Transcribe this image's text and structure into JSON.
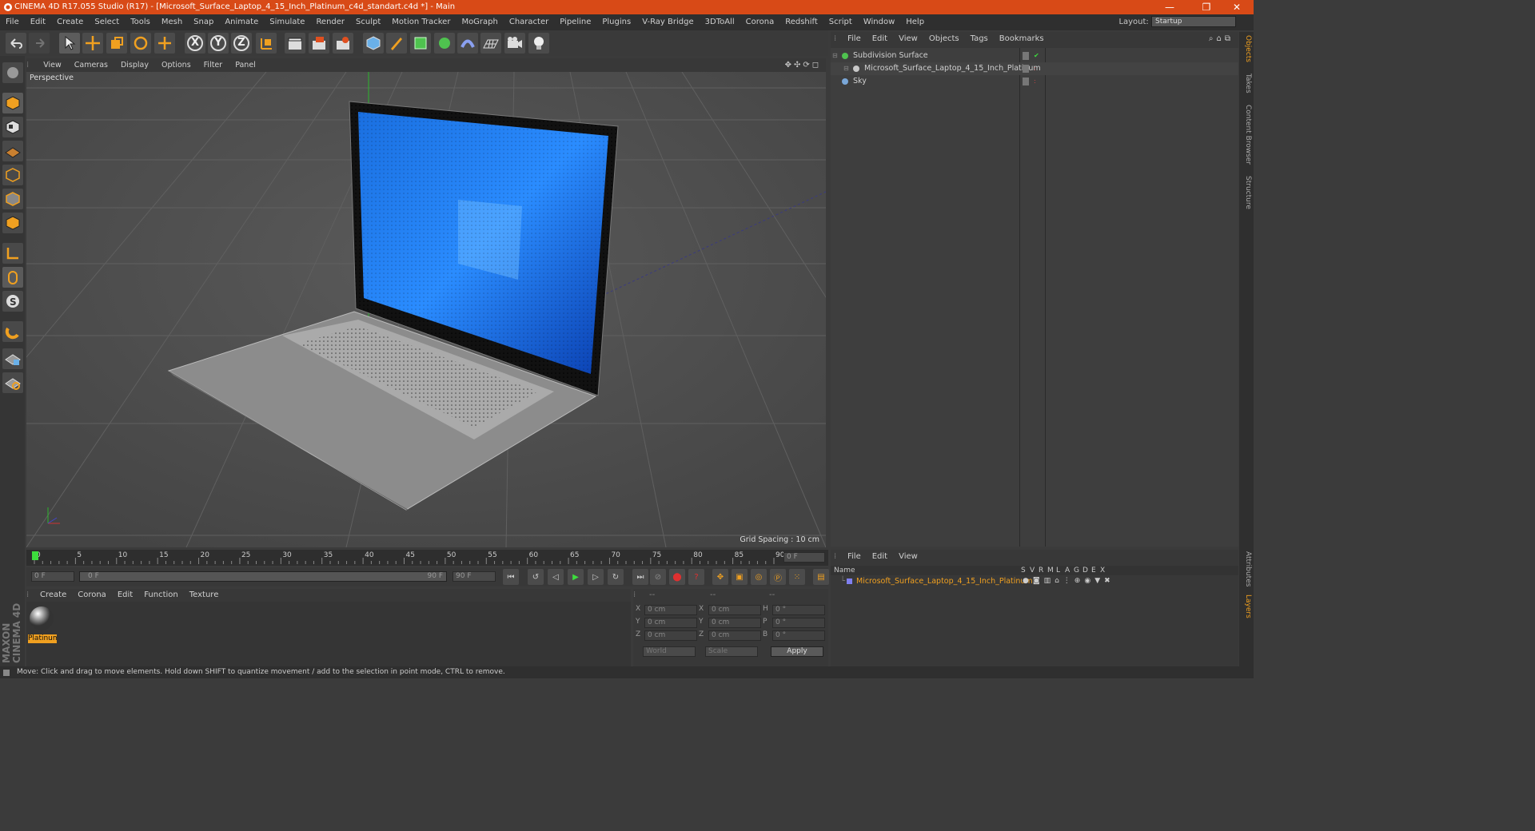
{
  "window": {
    "title": "CINEMA 4D R17.055 Studio (R17) - [Microsoft_Surface_Laptop_4_15_Inch_Platinum_c4d_standart.c4d *] - Main",
    "minimize": "—",
    "restore": "❐",
    "close": "✕"
  },
  "menu": {
    "items": [
      "File",
      "Edit",
      "Create",
      "Select",
      "Tools",
      "Mesh",
      "Snap",
      "Animate",
      "Simulate",
      "Render",
      "Sculpt",
      "Motion Tracker",
      "MoGraph",
      "Character",
      "Pipeline",
      "Plugins",
      "V-Ray Bridge",
      "3DToAll",
      "Corona",
      "Redshift",
      "Script",
      "Window",
      "Help"
    ],
    "layout_label": "Layout:",
    "layout_value": "Startup"
  },
  "toolbar": {
    "axis_x": "X",
    "axis_y": "Y",
    "axis_z": "Z"
  },
  "viewport": {
    "menu": [
      "View",
      "Cameras",
      "Display",
      "Options",
      "Filter",
      "Panel"
    ],
    "label": "Perspective",
    "grid_spacing": "Grid Spacing : 10 cm"
  },
  "timeline": {
    "ticks": [
      "0",
      "5",
      "10",
      "15",
      "20",
      "25",
      "30",
      "35",
      "40",
      "45",
      "50",
      "55",
      "60",
      "65",
      "70",
      "75",
      "80",
      "85",
      "90"
    ],
    "current_frame": "0 F",
    "start_field": "0 F",
    "range_start": "0 F",
    "range_end": "90 F",
    "end_field": "90 F"
  },
  "materials": {
    "menu": [
      "Create",
      "Corona",
      "Edit",
      "Function",
      "Texture"
    ],
    "items": [
      {
        "name": "Platinum"
      }
    ]
  },
  "coordinates": {
    "headers": [
      "--",
      "--",
      "--"
    ],
    "rows": [
      {
        "a": "X",
        "av": "0 cm",
        "b": "X",
        "bv": "0 cm",
        "c": "H",
        "cv": "0 °"
      },
      {
        "a": "Y",
        "av": "0 cm",
        "b": "Y",
        "bv": "0 cm",
        "c": "P",
        "cv": "0 °"
      },
      {
        "a": "Z",
        "av": "0 cm",
        "b": "Z",
        "bv": "0 cm",
        "c": "B",
        "cv": "0 °"
      }
    ],
    "mode": "World",
    "type": "Scale",
    "apply": "Apply"
  },
  "objects": {
    "menu": [
      "File",
      "Edit",
      "View",
      "Objects",
      "Tags",
      "Bookmarks"
    ],
    "tree": [
      {
        "name": "Subdivision Surface",
        "color": "#4fc24f"
      },
      {
        "name": "Microsoft_Surface_Laptop_4_15_Inch_Platinum",
        "color": "#c8c8c8"
      },
      {
        "name": "Sky",
        "color": "#7aa7d8"
      }
    ]
  },
  "attributes": {
    "menu": [
      "File",
      "Edit",
      "View"
    ],
    "col_name": "Name",
    "cols": [
      "S",
      "V",
      "R",
      "M",
      "L",
      "A",
      "G",
      "D",
      "E",
      "X"
    ],
    "row": "Microsoft_Surface_Laptop_4_15_Inch_Platinum"
  },
  "right_tabs": [
    "Objects",
    "Takes",
    "Content Browser",
    "Structure"
  ],
  "right_tabs_bottom": [
    "Attributes",
    "Layers"
  ],
  "brand": "MAXON CINEMA 4D",
  "status": "Move: Click and drag to move elements. Hold down SHIFT to quantize movement / add to the selection in point mode, CTRL to remove.",
  "colors": {
    "accent": "#d84a17",
    "selected": "#f0a020"
  }
}
